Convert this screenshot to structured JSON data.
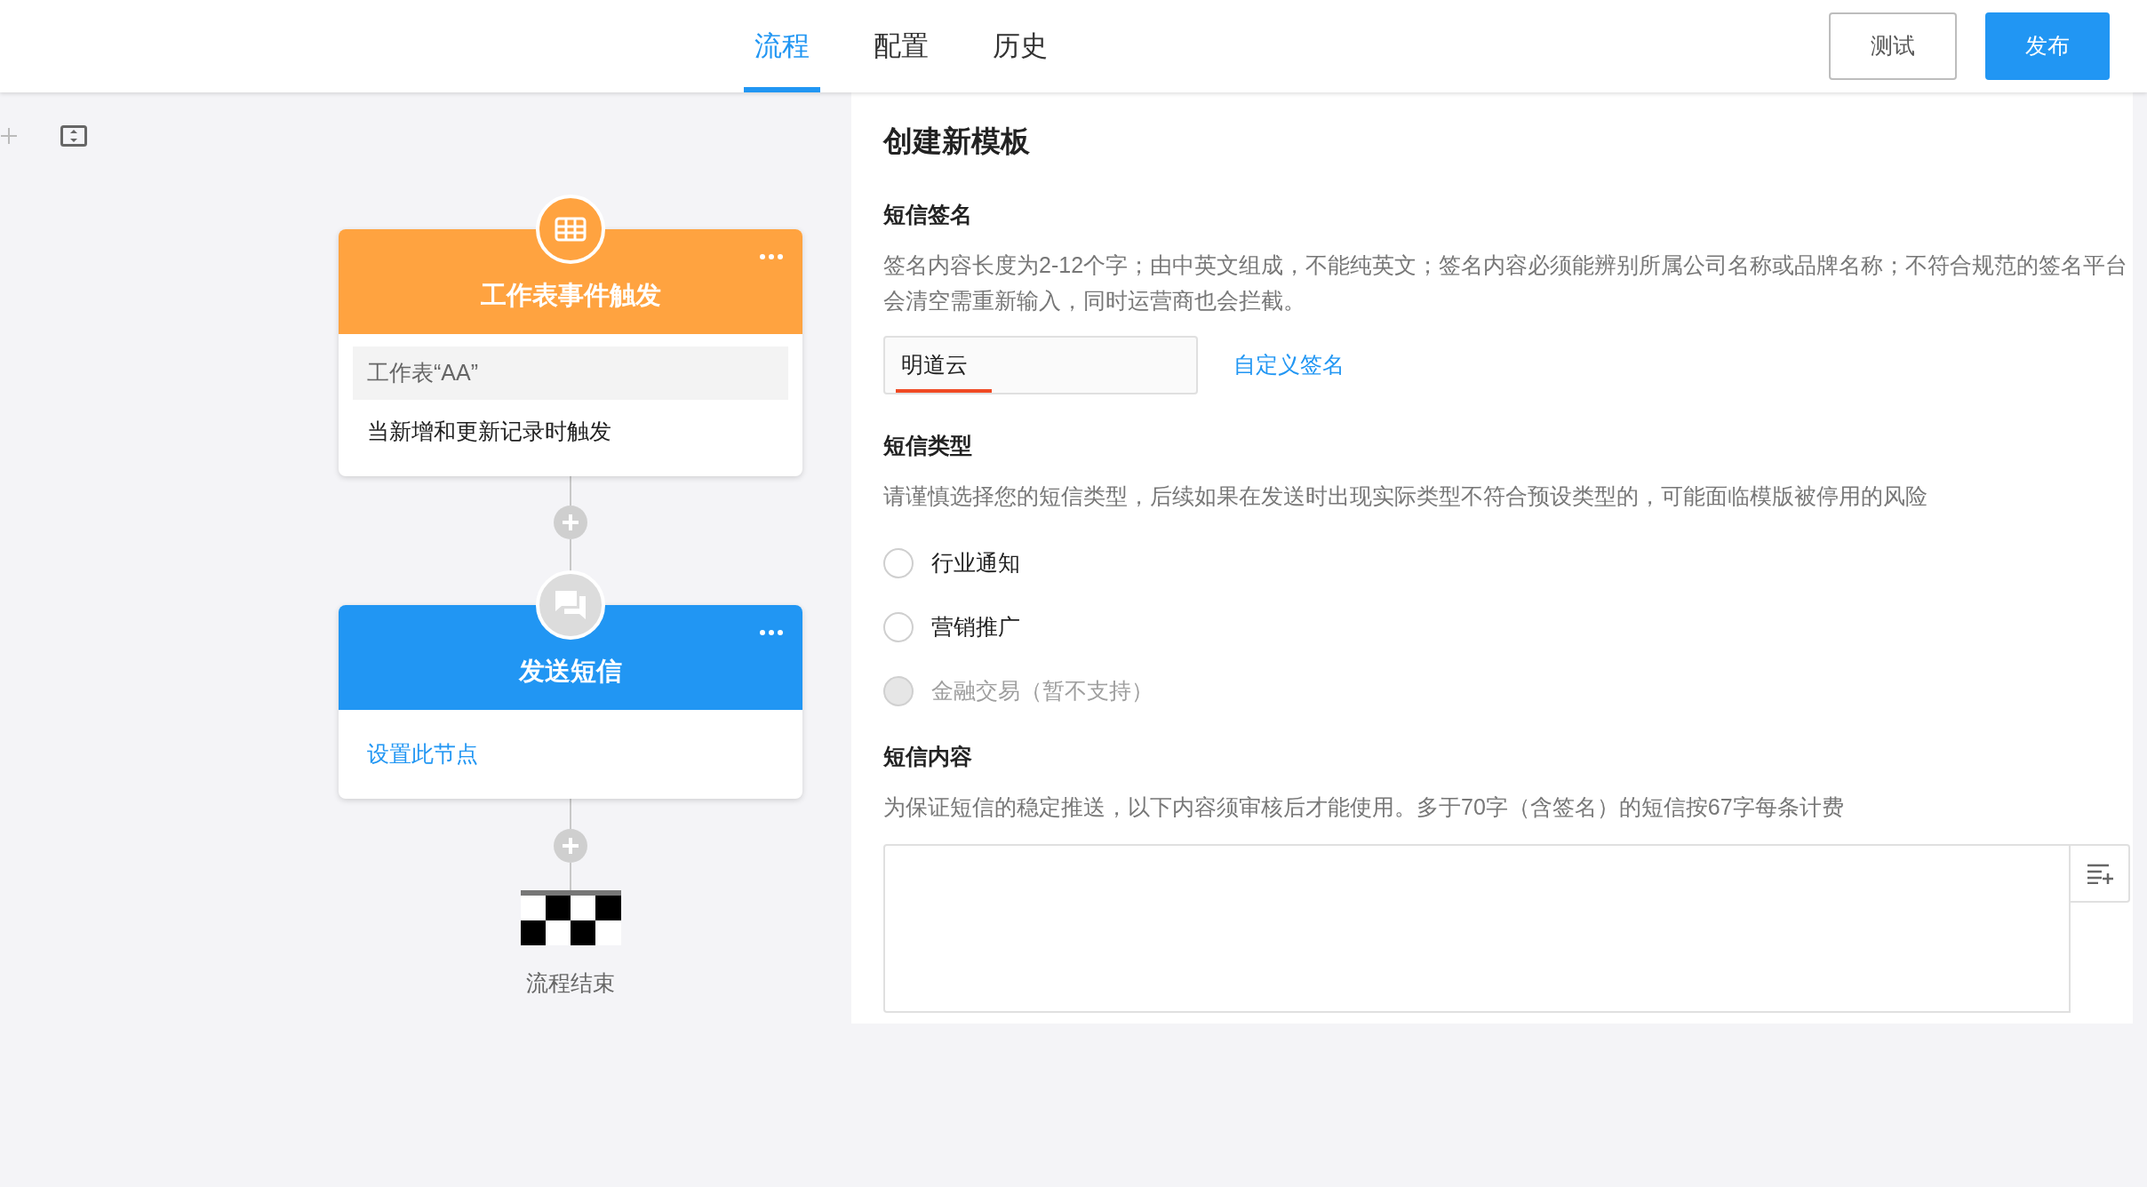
{
  "tabs": [
    {
      "label": "流程",
      "selected": true
    },
    {
      "label": "配置",
      "selected": false
    },
    {
      "label": "历史",
      "selected": false
    }
  ],
  "buttons": [
    {
      "label": "测试",
      "kind": "outline"
    },
    {
      "label": "发布",
      "kind": "primary"
    }
  ],
  "canvas": {
    "nodes": [
      {
        "kind": "trigger",
        "title": "工作表事件触发",
        "color": "#ffa340",
        "rows": [
          {
            "kind": "field",
            "text": "工作表“AA”"
          },
          {
            "kind": "plain",
            "text": "当新增和更新记录时触发"
          }
        ]
      },
      {
        "kind": "sms",
        "title": "发送短信",
        "color": "#2196f3",
        "rows": [
          {
            "kind": "link",
            "text": "设置此节点"
          }
        ]
      }
    ],
    "end": {
      "label": "流程结束"
    }
  },
  "panel": {
    "title": "创建新模板",
    "sections": [
      {
        "kind": "signature",
        "title": "短信签名",
        "description": "签名内容长度为2-12个字；由中英文组成，不能纯英文；签名内容必须能辨别所属公司名称或品牌名称；不符合规范的签名平台会清空需重新输入，同时运营商也会拦截。",
        "value": "明道云",
        "link": "自定义签名"
      },
      {
        "kind": "type",
        "title": "短信类型",
        "description": "请谨慎选择您的短信类型，后续如果在发送时出现实际类型不符合预设类型的，可能面临模版被停用的风险",
        "options": [
          {
            "label": "行业通知",
            "selected": false,
            "disabled": false
          },
          {
            "label": "营销推广",
            "selected": false,
            "disabled": false
          },
          {
            "label": "金融交易（暂不支持）",
            "selected": false,
            "disabled": true
          }
        ]
      },
      {
        "kind": "content",
        "title": "短信内容",
        "description": "为保证短信的稳定推送，以下内容须审核后才能使用。多于70字（含签名）的短信按67字每条计费"
      }
    ]
  }
}
